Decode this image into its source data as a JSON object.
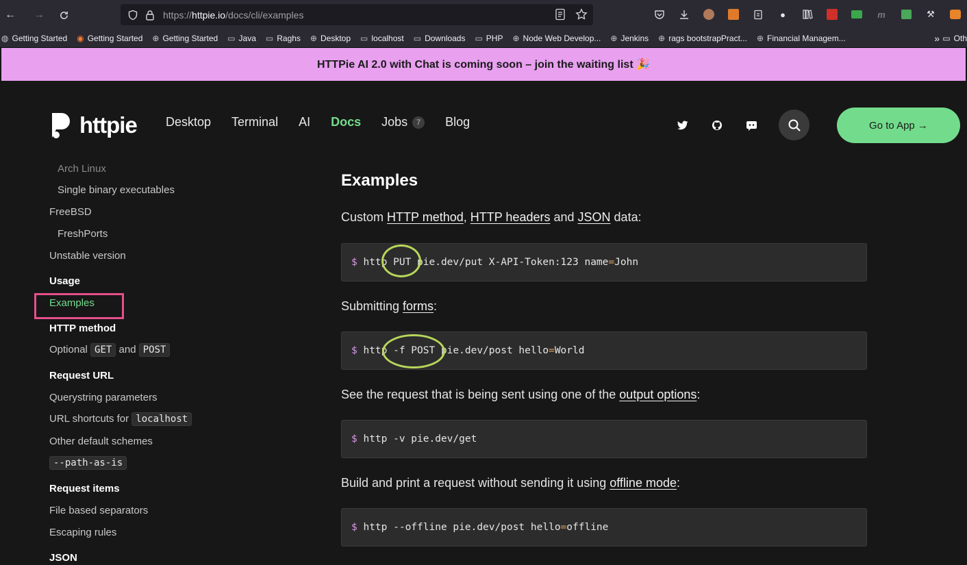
{
  "browser": {
    "url_prefix": "https://",
    "url_host": "httpie.io",
    "url_path": "/docs/cli/examples",
    "bookmarks": [
      {
        "label": "Getting Started",
        "icon": "firefox-icon"
      },
      {
        "label": "Getting Started",
        "icon": "firefox-icon"
      },
      {
        "label": "Getting Started",
        "icon": "globe-icon"
      },
      {
        "label": "Java",
        "icon": "folder-icon"
      },
      {
        "label": "Raghs",
        "icon": "folder-icon"
      },
      {
        "label": "Desktop",
        "icon": "globe-icon"
      },
      {
        "label": "localhost",
        "icon": "folder-icon"
      },
      {
        "label": "Downloads",
        "icon": "folder-icon"
      },
      {
        "label": "PHP",
        "icon": "folder-icon"
      },
      {
        "label": "Node Web Develop...",
        "icon": "globe-icon"
      },
      {
        "label": "Jenkins",
        "icon": "globe-icon"
      },
      {
        "label": "rags bootstrapPract...",
        "icon": "globe-icon"
      },
      {
        "label": "Financial Managem...",
        "icon": "globe-icon"
      }
    ],
    "bookmarks_more": "»",
    "bookmarks_other": "Oth"
  },
  "announcement": "HTTPie AI 2.0 with Chat is coming soon – join the waiting list 🎉",
  "header": {
    "logo_text": "httpie",
    "nav": [
      "Desktop",
      "Terminal",
      "AI",
      "Docs",
      "Jobs",
      "Blog"
    ],
    "jobs_count": "7",
    "go_to_app": "Go to App →"
  },
  "sidebar": {
    "items": {
      "arch": "Arch Linux",
      "single_binary": "Single binary executables",
      "freebsd": "FreeBSD",
      "freshports": "FreshPorts",
      "unstable": "Unstable version",
      "usage": "Usage",
      "examples": "Examples",
      "http_method": "HTTP method",
      "optional": "Optional",
      "get": "GET",
      "and": "and",
      "post": "POST",
      "request_url": "Request URL",
      "querystring": "Querystring parameters",
      "url_shortcuts": "URL shortcuts for",
      "localhost": "localhost",
      "other_schemes": "Other default schemes",
      "path_as_is": "--path-as-is",
      "request_items": "Request items",
      "file_separators": "File based separators",
      "escaping": "Escaping rules",
      "json": "JSON"
    }
  },
  "content": {
    "title": "Examples",
    "p1": {
      "a": "Custom ",
      "l1": "HTTP method",
      "b": ", ",
      "l2": "HTTP headers",
      "c": " and ",
      "l3": "JSON",
      "d": " data:"
    },
    "code1": {
      "prompt": "$",
      "a": " http PUT pie.dev/put X-API-Token:123 name",
      "op": "=",
      "b": "John"
    },
    "p2": {
      "a": "Submitting ",
      "l1": "forms",
      "b": ":"
    },
    "code2": {
      "prompt": "$",
      "a": " http -f POST pie.dev/post hello",
      "op": "=",
      "b": "World"
    },
    "p3": {
      "a": "See the request that is being sent using one of the ",
      "l1": "output options",
      "b": ":"
    },
    "code3": {
      "prompt": "$",
      "a": " http -v pie.dev/get"
    },
    "p4": {
      "a": "Build and print a request without sending it using ",
      "l1": "offline mode",
      "b": ":"
    },
    "code4": {
      "prompt": "$",
      "a": " http --offline pie.dev/post hello",
      "op": "=",
      "b": "offline"
    }
  },
  "colors": {
    "accent_green": "#73dc8c",
    "announcement_bg": "#e8a0ef",
    "annotation_pink": "#e64f8a",
    "annotation_lime": "#b8d65a"
  }
}
